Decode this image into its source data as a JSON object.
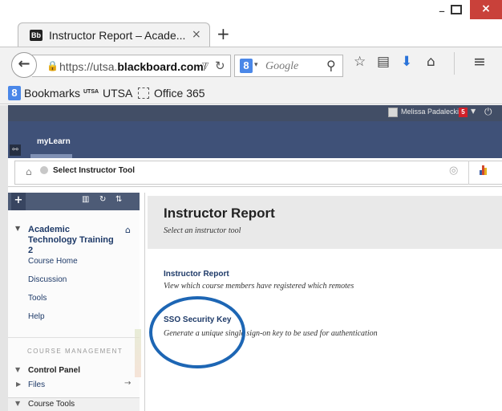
{
  "browser": {
    "tab_title": "Instructor Report – Acade...",
    "tab_favicon": "Bb",
    "tab_close": "×",
    "new_tab": "+",
    "url_prefix": "https://utsa.",
    "url_domain": "blackboard.com",
    "url_suffix": "/",
    "search_engine_letter": "8",
    "search_placeholder": "Google",
    "bookmarks": [
      {
        "label": "Bookmarks"
      },
      {
        "label": "UTSA"
      },
      {
        "label": "Office 365"
      }
    ],
    "bookmark_utsa_mark": "UTSA",
    "window_close": "×"
  },
  "header": {
    "user_name": "Melissa Padalecki",
    "notification_count": "5",
    "tab_label": "myLearn"
  },
  "breadcrumb": {
    "current": "Select Instructor Tool"
  },
  "course_menu": {
    "course_name": "Academic Technology Training 2",
    "links": [
      {
        "label": "Course Home"
      },
      {
        "label": "Discussion"
      },
      {
        "label": "Tools"
      },
      {
        "label": "Help"
      }
    ],
    "management_label": "COURSE MANAGEMENT",
    "control_panel": "Control Panel",
    "files": "Files",
    "course_tools": "Course Tools"
  },
  "content": {
    "title": "Instructor Report",
    "subtitle": "Select an instructor tool",
    "tools": [
      {
        "title": "Instructor Report",
        "description": "View which course members have registered which remotes"
      },
      {
        "title": "SSO Security Key",
        "description": "Generate a unique single sign-on key to be used for authentication"
      }
    ]
  },
  "colors": {
    "header_bg": "#3f5178",
    "link": "#1e3a68",
    "highlight": "#1d66b4",
    "notification": "#d1212a"
  },
  "icons": [
    "back-arrow-icon",
    "lock-icon",
    "reload-icon",
    "search-icon",
    "star-icon",
    "reading-list-icon",
    "download-icon",
    "home-icon",
    "menu-icon",
    "power-icon",
    "link-icon",
    "eye-icon",
    "chart-icon",
    "add-icon",
    "reorder-icon",
    "refresh-icon",
    "sort-icon"
  ]
}
